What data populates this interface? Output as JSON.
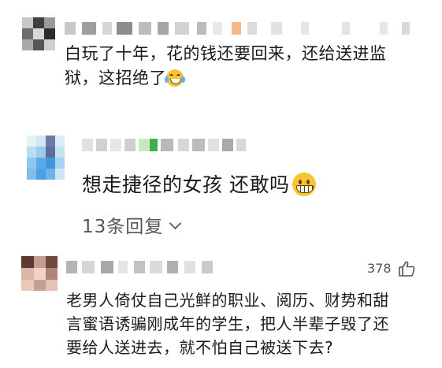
{
  "comments": [
    {
      "text_line1": "白玩了十年，花的钱还要回来，还给送进监",
      "text_line2": "狱，这招绝了",
      "emoji": "laughing-crying-emoji"
    },
    {
      "text": "想走捷径的女孩 还敢吗",
      "emoji": "grinning-emoji",
      "replies_label": "13条回复"
    },
    {
      "likes": "378",
      "text_line1": "老男人倚仗自己光鲜的职业、阅历、财势和甜",
      "text_line2": "言蜜语诱骗刚成年的学生，把人半辈子毁了还",
      "text_line3": "要给人送进去，就不怕自己被送下去?"
    }
  ],
  "colors": {
    "text": "#1a1a1a",
    "meta": "#555555",
    "background": "#ffffff"
  }
}
